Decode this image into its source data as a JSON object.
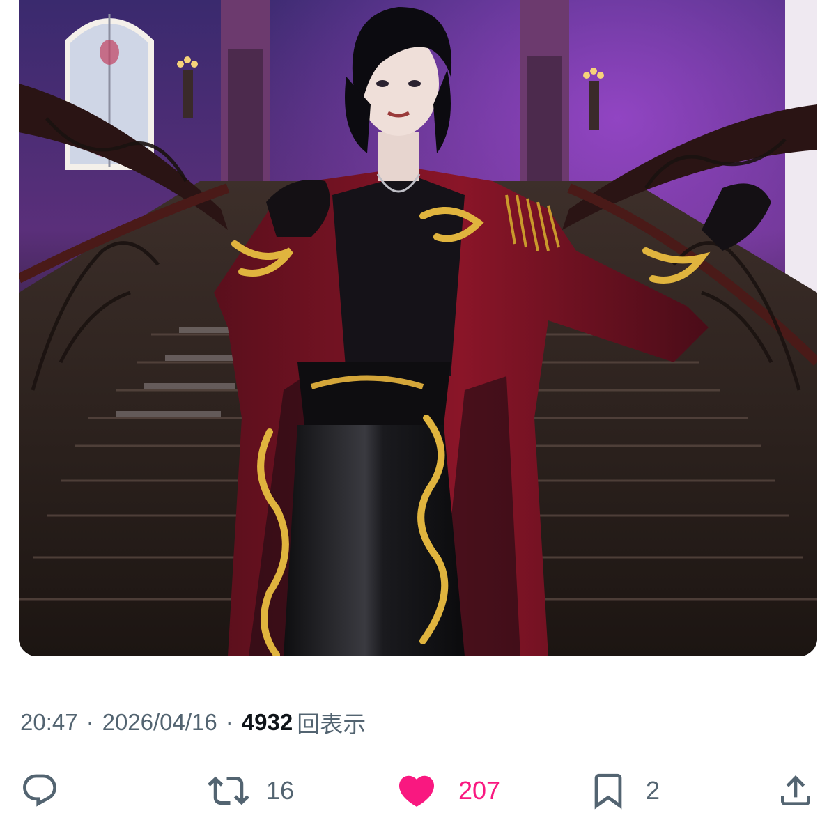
{
  "post": {
    "media": {
      "icon": "photo"
    },
    "meta": {
      "time": "20:47",
      "separator": "·",
      "date": "2026/04/16",
      "views_count": "4932",
      "views_label": "回表示"
    },
    "actions": {
      "reply": {
        "icon": "reply-icon"
      },
      "retweet": {
        "icon": "retweet-icon",
        "count": "16"
      },
      "like": {
        "icon": "heart-icon",
        "count": "207",
        "liked": true,
        "color": "#f91880"
      },
      "bookmark": {
        "icon": "bookmark-icon",
        "count": "2"
      },
      "share": {
        "icon": "share-icon"
      }
    }
  },
  "colors": {
    "muted_text": "#536471",
    "primary_text": "#0f1419",
    "like_pink": "#f91880"
  }
}
